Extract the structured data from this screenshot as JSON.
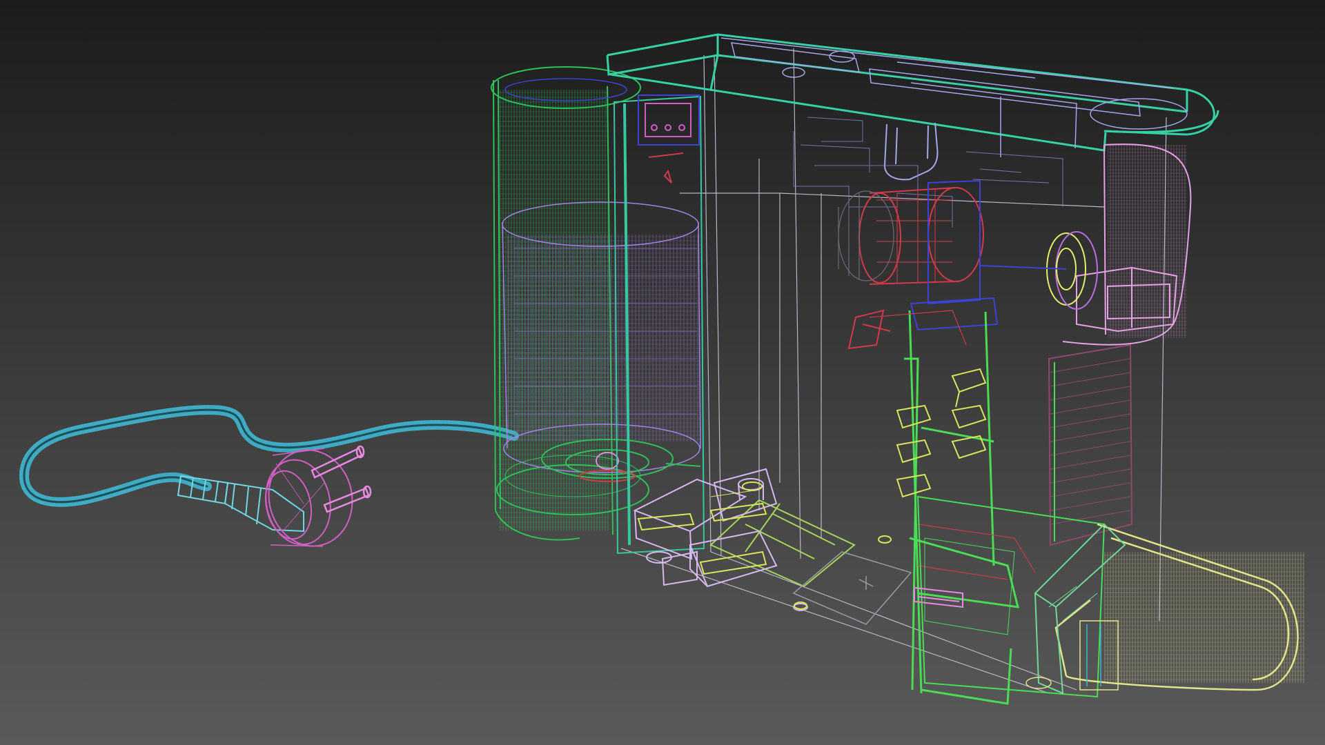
{
  "scene": {
    "subject": "coffee-machine-wireframe",
    "render_mode": "wireframe",
    "background": {
      "top": "#1c1c1c",
      "bottom": "#5a5a5a"
    },
    "colors": {
      "cord": "#3fb6cf",
      "plug": "#d15fc6",
      "plug_pins": "#e78ae0",
      "plug_strain": "#6fd7e3",
      "tank": "#2fc05a",
      "tank_inner": "#a582e8",
      "body": "#35c9a0",
      "frame_lines": "#b8b8c8",
      "top_housing": "#36d1a4",
      "top_detail": "#a7a7f0",
      "pump": "#d23a4a",
      "pump_blue": "#3d43d8",
      "brew_head": "#e6a2e6",
      "yellow_parts": "#d9e659",
      "circuit": "#a8d65a",
      "green_chassis": "#4bdc56",
      "drip_tray": "#e2e48a",
      "drip_tray_side": "#73d89a",
      "front_panel": "#8e4a6a",
      "base_parts": "#d7b8ef"
    }
  }
}
